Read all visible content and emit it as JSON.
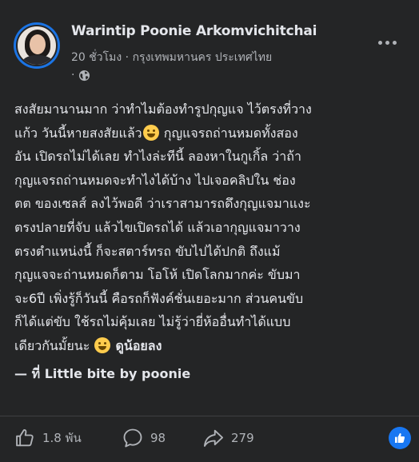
{
  "post": {
    "author": "Warintip Poonie Arkomvichitchai",
    "time": "20 ชั่วโมง",
    "separator": "·",
    "place": "กรุงเทพมหานคร ประเทศไทย",
    "privacy_separator": "·",
    "privacy_icon": "globe-icon",
    "body_lines": [
      "สงสัยมานานมาก ว่าทำไมต้องทำรูปกุญแจ ไว้ตรงที่วาง",
      "แก้ว วันนี้หายสงสัยแล้ว",
      "กุญแจรถถ่านหมดทั้งสอง",
      "อัน เปิดรถไม่ได้เลย ทำไงล่ะทีนี้ ลองหาในกูเกิ้ล ว่าถ้า",
      "กุญแจรถถ่านหมดจะทำไงได้บ้าง ไปเจอคลิปใน ช่อง",
      "ตต ของเซลส์ ลงไว้พอดี ว่าเราสามารถดึงกุญแจมาแงะ",
      "ตรงปลายที่จับ แล้วไขเปิดรถได้ แล้วเอากุญแจมาวาง",
      "ตรงตำแหน่งนี้ ก็จะสตาร์ทรถ ขับไปได้ปกติ ถึงแม้",
      "กุญแจจะถ่านหมดก็ตาม โอโห้ เปิดโลกมากค่ะ ขับมา",
      "จะ6ปี เพิ่งรู้ก็วันนี้ คือรถก็ฟังค์ชั่นเยอะมาก ส่วนคนขับ",
      "ก็ได้แต่ขับ ใช้รถไม่คุ้มเลย ไม่รู้ว่ายี่ห้ออื่นทำได้แบบ",
      "เดียวกันมั้ยนะ",
      "ดูน้อยลง"
    ],
    "location_line": "— ที่ Little bite by poonie"
  },
  "actions": {
    "likes": "1.8 พัน",
    "comments": "98",
    "shares": "279"
  },
  "colors": {
    "background": "#242526",
    "text": "#e4e6eb",
    "secondary": "#b0b3b8",
    "accent": "#1877f2"
  }
}
